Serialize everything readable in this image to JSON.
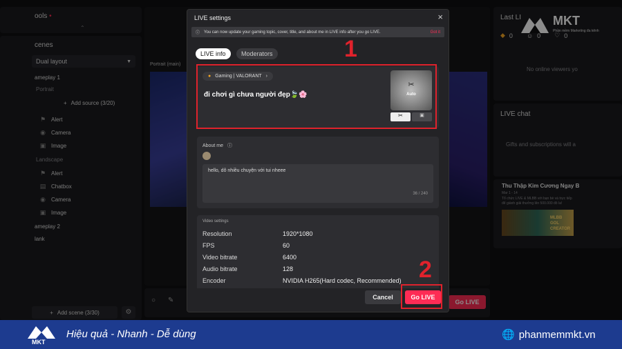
{
  "left": {
    "tools_label": "ools",
    "tools_dot": "•",
    "collapse": "⌃",
    "scenes_label": "cenes",
    "layout_select": "Dual layout",
    "group1": "ameplay 1",
    "portrait": "Portrait",
    "add_source": "Add source (3/20)",
    "src_alert": "Alert",
    "src_camera": "Camera",
    "src_image": "Image",
    "landscape": "Landscape",
    "src_alert2": "Alert",
    "src_chatbox": "Chatbox",
    "src_camera2": "Camera",
    "src_image2": "Image",
    "group2": "ameplay 2",
    "group3": "lank",
    "add_scene": "Add scene (3/30)"
  },
  "center": {
    "portrait_main": "Portrait (main)",
    "go_live_bg": "Go LIVE"
  },
  "right": {
    "last_live": "Last LI",
    "count1": "0",
    "count2": "0",
    "count3": "0",
    "no_viewers": "No online viewers yo",
    "live_chat": "LIVE chat",
    "gifts_msg": "Gifts and subscriptions will a",
    "promo_title": "Thu Thập Kim Cương Ngay B",
    "promo_sub1": "Mar 1 - 14",
    "promo_sub2": "Tổ chức LIVE & MLBB với bạn bè và trực tiếp",
    "promo_sub3": "để giành giải thưởng lên 500.000 đô la!",
    "promo_img_text": "MLBB GOL CREATOR"
  },
  "watermark": {
    "brand": "MKT",
    "tag": "Phần mềm Marketing đa kênh"
  },
  "modal": {
    "title": "LIVE settings",
    "close": "×",
    "banner": "You can now update your gaming topic, cover, title, and about me in LIVE info after you go LIVE.",
    "got_it": "Got it",
    "tab_info": "LIVE info",
    "tab_mods": "Moderators",
    "topic": "Gaming | VALORANT",
    "title_text": "đi chơi gì chưa người đẹp🍃🌸",
    "cover_label": "Auto",
    "about_label": "About me",
    "about_text": "hello, dô nhiều chuyện với tui nheee",
    "counter": "36 / 240",
    "video_settings": "Video settings",
    "settings": [
      {
        "k": "Resolution",
        "v": "1920*1080"
      },
      {
        "k": "FPS",
        "v": "60"
      },
      {
        "k": "Video bitrate",
        "v": "6400"
      },
      {
        "k": "Audio bitrate",
        "v": "128"
      },
      {
        "k": "Encoder",
        "v": "NVIDIA H265(Hard codec, Recommended)"
      }
    ],
    "cancel": "Cancel",
    "go_live": "Go LIVE"
  },
  "annotations": {
    "one": "1",
    "two": "2"
  },
  "footer": {
    "slogan": "Hiệu quả - Nhanh - Dễ dùng",
    "website": "phanmemmkt.vn",
    "brand": "MKT"
  },
  "colors": {
    "accent": "#fe2c55",
    "annot": "#e0222c",
    "footer": "#1d3b8f"
  }
}
